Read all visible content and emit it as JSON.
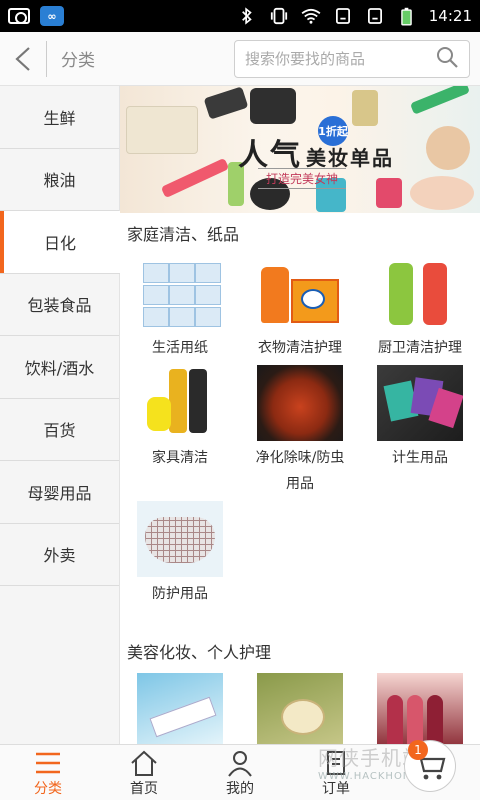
{
  "status_bar": {
    "time": "14:21",
    "icons": [
      "camera-icon",
      "app-icon",
      "bluetooth-icon",
      "vibrate-icon",
      "wifi-icon",
      "signal-icon",
      "signal-icon",
      "battery-icon"
    ]
  },
  "header": {
    "back_icon": "chevron-left-icon",
    "title": "分类",
    "search_placeholder": "搜索你要找的商品"
  },
  "sidebar": {
    "items": [
      {
        "label": "生鲜"
      },
      {
        "label": "粮油"
      },
      {
        "label": "日化",
        "active": true
      },
      {
        "label": "包装食品"
      },
      {
        "label": "饮料/酒水"
      },
      {
        "label": "百货"
      },
      {
        "label": "母婴用品"
      },
      {
        "label": "外卖"
      }
    ]
  },
  "banner": {
    "badge": "1折起",
    "title_main": "人气",
    "title_sub": "美妆单品",
    "slogan": "打造完美女神"
  },
  "sections": [
    {
      "title": "家庭清洁、纸品",
      "items": [
        {
          "label": "生活用纸"
        },
        {
          "label": "衣物清洁护理"
        },
        {
          "label": "厨卫清洁护理"
        },
        {
          "label": "家具清洁"
        },
        {
          "label": "净化除味/防虫用品"
        },
        {
          "label": "计生用品"
        },
        {
          "label": "防护用品"
        }
      ]
    },
    {
      "title": "美容化妆、个人护理",
      "items": [
        {
          "label": ""
        },
        {
          "label": ""
        },
        {
          "label": ""
        }
      ]
    }
  ],
  "bottom_nav": {
    "items": [
      {
        "label": "分类",
        "icon": "menu-icon",
        "active": true
      },
      {
        "label": "首页",
        "icon": "home-icon"
      },
      {
        "label": "我的",
        "icon": "user-icon"
      },
      {
        "label": "订单",
        "icon": "order-icon"
      }
    ],
    "cart_badge": "1"
  },
  "watermark": {
    "line1": "网侠手机站",
    "line2": "WWW.HACKHOME.COM"
  },
  "colors": {
    "accent": "#f2661d"
  }
}
